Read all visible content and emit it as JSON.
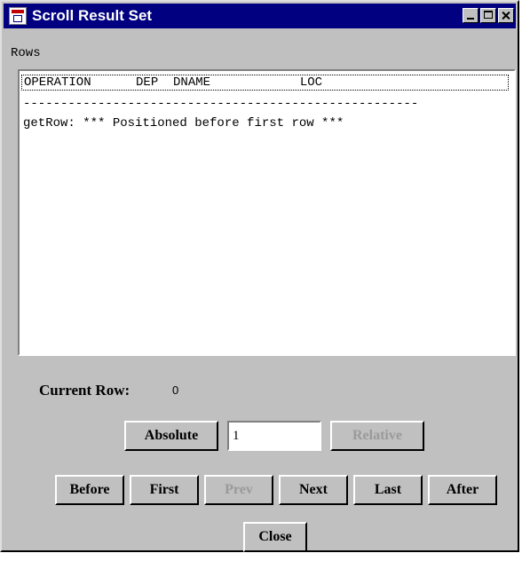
{
  "window": {
    "title": "Scroll Result Set"
  },
  "rows": {
    "label": "Rows",
    "header": "OPERATION      DEP  DNAME            LOC",
    "separator": "-----------------------------------------------------",
    "lines": [
      "getRow: *** Positioned before first row ***"
    ]
  },
  "status": {
    "current_row_label": "Current Row:",
    "current_row_value": "0"
  },
  "controls": {
    "absolute_label": "Absolute",
    "absolute_value": "1",
    "relative_label": "Relative",
    "before_label": "Before",
    "first_label": "First",
    "prev_label": "Prev",
    "next_label": "Next",
    "last_label": "Last",
    "after_label": "After",
    "close_label": "Close"
  },
  "colors": {
    "titlebar": "#000080",
    "face": "#c0c0c0",
    "disabled_text": "#9a9a9a"
  }
}
